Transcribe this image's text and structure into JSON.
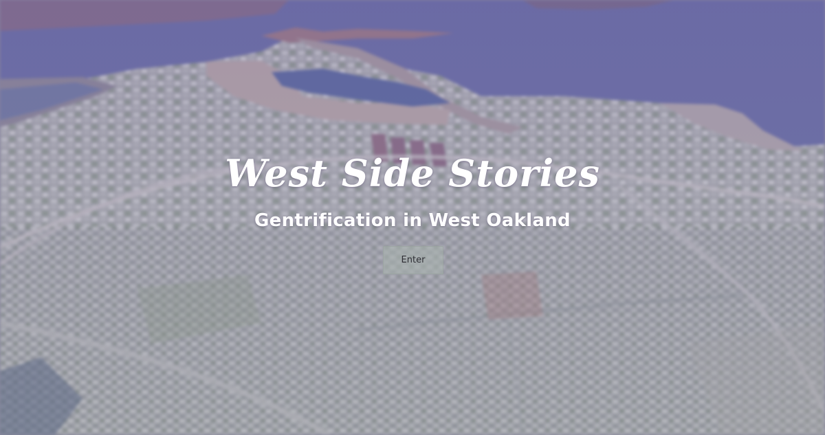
{
  "hero": {
    "title": "West Side Stories",
    "subtitle": "Gentrification in West Oakland",
    "enter_label": "Enter"
  },
  "colors": {
    "overlay_tint": "#7a6aa8",
    "water": "#5e6aa0",
    "text": "#ffffff",
    "button_bg": "#aab4af"
  }
}
